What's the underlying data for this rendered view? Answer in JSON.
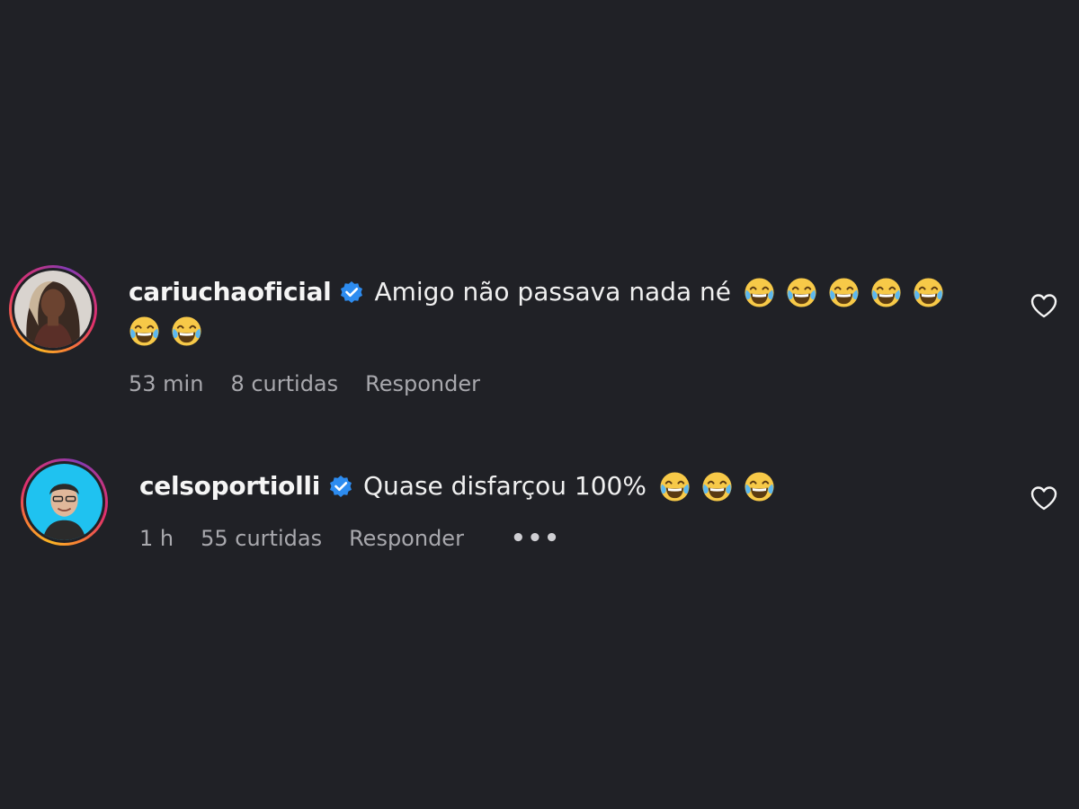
{
  "comments": [
    {
      "username": "cariuchaoficial",
      "text": "Amigo não passava nada né",
      "time": "53 min",
      "likes": "8 curtidas",
      "reply_label": "Responder",
      "emojis_line1": 5,
      "emojis_line2": 2,
      "verified": true
    },
    {
      "username": "celsoportiolli",
      "text": "Quase disfarçou 100%",
      "time": "1 h",
      "likes": "55 curtidas",
      "reply_label": "Responder",
      "more_label": "•••",
      "emojis_line1": 3,
      "verified": true
    }
  ],
  "icons": {
    "verified": "verified-badge-icon",
    "emoji": "face-with-tears-of-joy-emoji",
    "like": "heart-outline-icon"
  },
  "colors": {
    "background": "#202126",
    "verified": "#2d8cf0",
    "meta_text": "#a8a8ad"
  }
}
